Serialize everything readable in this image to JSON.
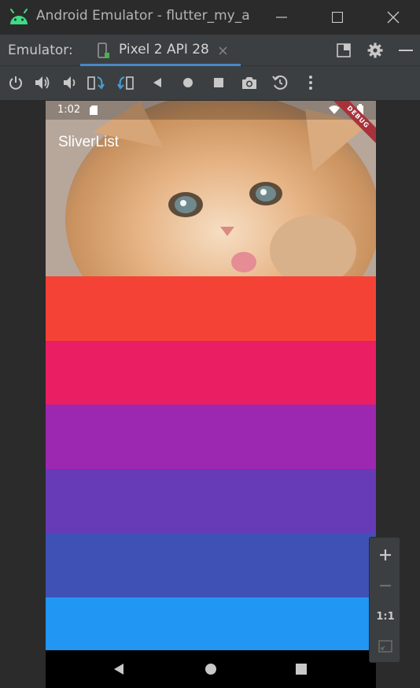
{
  "window": {
    "title": "Android Emulator - flutter_my_a"
  },
  "tabs": {
    "label": "Emulator:",
    "device": "Pixel 2 API 28"
  },
  "toolbar": {
    "icons": [
      "power-icon",
      "volume-up-icon",
      "volume-down-icon",
      "rotate-left-icon",
      "rotate-right-icon",
      "back-icon",
      "home-icon",
      "overview-icon",
      "camera-icon",
      "snapshot-icon",
      "more-icon"
    ]
  },
  "phone": {
    "status_time": "1:02",
    "appbar_title": "SliverList",
    "debug_banner": "DEBUG",
    "list_colors": [
      "#f44336",
      "#e91e63",
      "#9c27b0",
      "#673ab7",
      "#3f51b5",
      "#2196f3"
    ]
  },
  "zoom": {
    "ratio_label": "1:1"
  }
}
